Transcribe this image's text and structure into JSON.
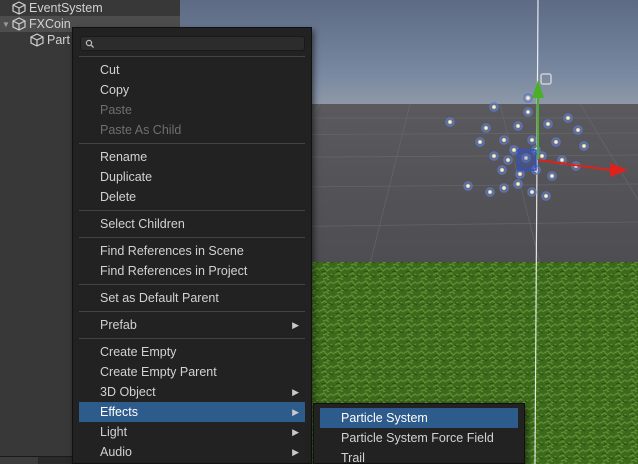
{
  "hierarchy": {
    "items": [
      {
        "label": "EventSystem"
      },
      {
        "label": "FXCoin"
      },
      {
        "label": "Part"
      }
    ]
  },
  "search": {
    "placeholder": ""
  },
  "context_menu": {
    "cut": "Cut",
    "copy": "Copy",
    "paste": "Paste",
    "paste_as_child": "Paste As Child",
    "rename": "Rename",
    "duplicate": "Duplicate",
    "delete": "Delete",
    "select_children": "Select Children",
    "find_refs_scene": "Find References in Scene",
    "find_refs_project": "Find References in Project",
    "set_default_parent": "Set as Default Parent",
    "prefab": "Prefab",
    "create_empty": "Create Empty",
    "create_empty_parent": "Create Empty Parent",
    "object_3d": "3D Object",
    "effects": "Effects",
    "light": "Light",
    "audio": "Audio"
  },
  "submenu": {
    "particle_system": "Particle System",
    "particle_force_field": "Particle System Force Field",
    "trail": "Trail"
  },
  "icons": {
    "hierarchy_object": "cube-icon",
    "search": "search-icon",
    "submenu_arrow": "chevron-right-icon",
    "expand_arrow": "triangle-down-icon"
  },
  "colors": {
    "menu_highlight": "#2d5b8c",
    "gizmo_y": "#4caf28",
    "gizmo_x": "#e0201a",
    "gizmo_z": "#2850e0"
  }
}
